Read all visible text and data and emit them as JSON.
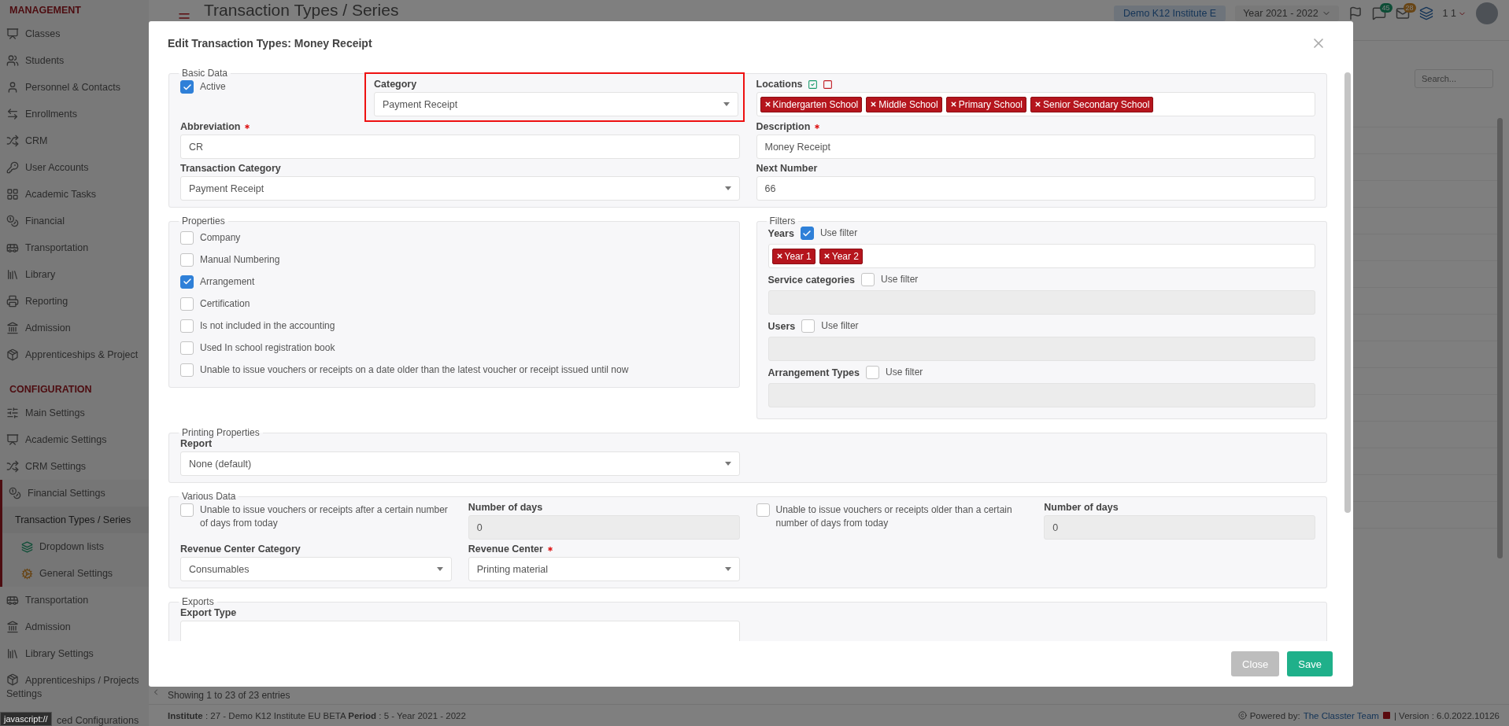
{
  "sidebar": {
    "sections": [
      {
        "title": "MANAGEMENT",
        "items": [
          {
            "label": "Classes",
            "selected": false
          },
          {
            "label": "Students",
            "selected": false
          },
          {
            "label": "Personnel & Contacts",
            "selected": false
          },
          {
            "label": "Enrollments",
            "selected": false
          },
          {
            "label": "CRM",
            "selected": false
          },
          {
            "label": "User Accounts",
            "selected": false
          },
          {
            "label": "Academic Tasks",
            "selected": false
          },
          {
            "label": "Financial",
            "selected": false
          },
          {
            "label": "Transportation",
            "selected": false
          },
          {
            "label": "Library",
            "selected": false
          },
          {
            "label": "Reporting",
            "selected": false
          },
          {
            "label": "Admission",
            "selected": false
          },
          {
            "label": "Apprenticeships & Project",
            "selected": false
          }
        ]
      },
      {
        "title": "CONFIGURATION",
        "items": [
          {
            "label": "Main Settings",
            "selected": false
          },
          {
            "label": "Academic Settings",
            "selected": false
          },
          {
            "label": "CRM Settings",
            "selected": false
          },
          {
            "label": "Financial Settings",
            "selected": false,
            "expanded": true,
            "children": [
              {
                "label": "Transaction Types / Series",
                "selected": true
              },
              {
                "label": "Dropdown lists",
                "selected": false
              },
              {
                "label": "General Settings",
                "selected": false
              }
            ]
          },
          {
            "label": "Transportation",
            "selected": false
          },
          {
            "label": "Admission",
            "selected": false
          },
          {
            "label": "Library Settings",
            "selected": false
          },
          {
            "label": "Apprenticeships / Projects Settings",
            "selected": false
          },
          {
            "label": "ced Configurations",
            "selected": false
          }
        ]
      }
    ]
  },
  "topbar": {
    "title": "Transaction Types / Series",
    "institute": "Demo K12 Institute E",
    "year": "Year 2021 - 2022",
    "messages_count": "45",
    "mail_count": "28",
    "user": "1 1"
  },
  "list": {
    "search": {
      "placeholder": "Search..."
    },
    "summary": "Showing 1 to 23 of 23 entries"
  },
  "status_bar": {
    "info": "**Institute** : 27 - Demo K12 Institute EU BETA **Period** : 5 - Year 2021 - 2022",
    "powered_by": "Powered by:",
    "team": "The Classter Team",
    "version": "| Version : 6.0.2022.10126"
  },
  "browser_status": "javascript://",
  "modal": {
    "title": "Edit Transaction Types: Money Receipt",
    "basic_data": {
      "legend": "Basic Data",
      "active": {
        "label": "Active",
        "checked": true
      },
      "category": {
        "label": "Category",
        "value": "Payment Receipt",
        "highlighted": true
      },
      "locations": {
        "label": "Locations",
        "tags": [
          "Kindergarten School",
          "Middle School",
          "Primary School",
          "Senior Secondary School"
        ]
      },
      "abbreviation": {
        "label": "Abbreviation",
        "required": true,
        "value": "CR"
      },
      "description": {
        "label": "Description",
        "required": true,
        "value": "Money Receipt"
      },
      "transaction_category": {
        "label": "Transaction Category",
        "value": "Payment Receipt"
      },
      "next_number": {
        "label": "Next Number",
        "value": "66"
      }
    },
    "properties": {
      "legend": "Properties",
      "options": [
        {
          "label": "Company",
          "checked": false
        },
        {
          "label": "Manual Numbering",
          "checked": false
        },
        {
          "label": "Arrangement",
          "checked": true
        },
        {
          "label": "Certification",
          "checked": false
        },
        {
          "label": "Is not included in the accounting",
          "checked": false
        },
        {
          "label": "Used In school registration book",
          "checked": false
        },
        {
          "label": "Unable to issue vouchers or receipts on a date older than the latest voucher or receipt issued until now",
          "checked": false
        }
      ]
    },
    "filters": {
      "legend": "Filters",
      "groups": [
        {
          "label": "Years",
          "filter_label": "Use filter",
          "checked": true,
          "disabled": false,
          "tags": [
            "Year 1",
            "Year 2"
          ]
        },
        {
          "label": "Service categories",
          "filter_label": "Use filter",
          "checked": false,
          "disabled": true
        },
        {
          "label": "Users",
          "filter_label": "Use filter",
          "checked": false,
          "disabled": true
        },
        {
          "label": "Arrangement Types",
          "filter_label": "Use filter",
          "checked": false,
          "disabled": true
        }
      ]
    },
    "printing": {
      "legend": "Printing Properties",
      "report": {
        "label": "Report",
        "value": "None (default)"
      }
    },
    "various": {
      "legend": "Various Data",
      "rules": [
        {
          "label": "Unable to issue vouchers or receipts after a certain number of days from today",
          "checked": false,
          "days_label": "Number of days",
          "days_value": "0"
        },
        {
          "label": "Unable to issue vouchers or receipts older than a certain number of days from today",
          "checked": false,
          "days_label": "Number of days",
          "days_value": "0"
        }
      ],
      "revenue_center_category": {
        "label": "Revenue Center Category",
        "value": "Consumables"
      },
      "revenue_center": {
        "label": "Revenue Center",
        "required": true,
        "value": "Printing material"
      }
    },
    "exports": {
      "legend": "Exports",
      "export_type": {
        "label": "Export Type"
      }
    },
    "buttons": [
      {
        "label": "Close",
        "kind": "secondary"
      },
      {
        "label": "Save",
        "kind": "primary"
      }
    ]
  }
}
